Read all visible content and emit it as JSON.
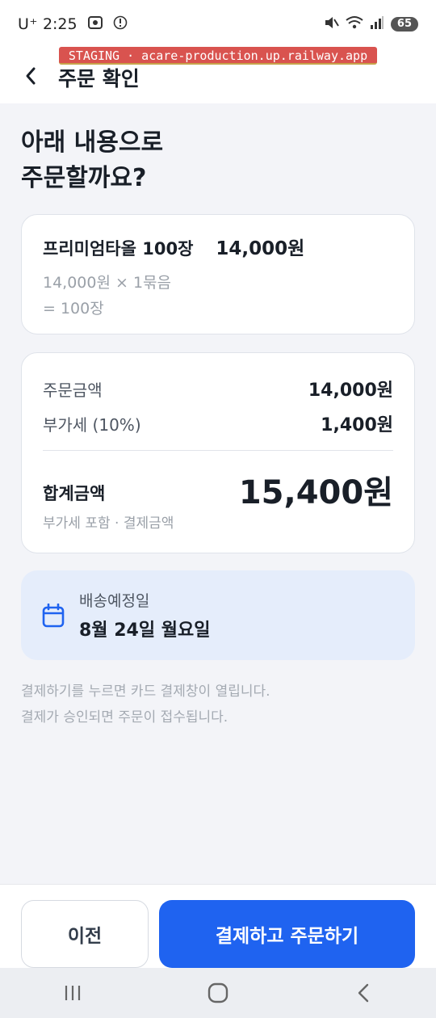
{
  "status_bar": {
    "carrier": "U⁺",
    "time": "2:25",
    "battery": "65",
    "icons": [
      "screenshot-icon",
      "info-icon",
      "mute-icon",
      "wifi-icon",
      "signal-icon",
      "battery-icon"
    ]
  },
  "staging_banner": "STAGING · acare-production.up.railway.app",
  "header": {
    "title": "주문 확인",
    "back_icon": "chevron-left-icon"
  },
  "main_title_line1": "아래 내용으로",
  "main_title_line2": "주문할까요?",
  "order_item": {
    "name": "프리미엄타올 100장",
    "price": "14,000원",
    "detail_line1": "14,000원 × 1묶음",
    "detail_line2": "= 100장"
  },
  "summary": {
    "order_amount_label": "주문금액",
    "order_amount_value": "14,000원",
    "vat_label": "부가세 (10%)",
    "vat_value": "1,400원",
    "total_label": "합계금액",
    "total_sub": "부가세 포함 · 결제금액",
    "total_value": "15,400원"
  },
  "delivery": {
    "label": "배송예정일",
    "date": "8월 24일 월요일",
    "icon": "calendar-icon"
  },
  "notice_line1": "결제하기를 누르면 카드 결제창이 열립니다.",
  "notice_line2": "결제가 승인되면 주문이 접수됩니다.",
  "buttons": {
    "prev": "이전",
    "pay": "결제하고 주문하기"
  },
  "colors": {
    "accent": "#1f63f0",
    "background": "#f3f4f8",
    "delivery_bg": "#e5edfb",
    "staging": "#d9534f"
  }
}
